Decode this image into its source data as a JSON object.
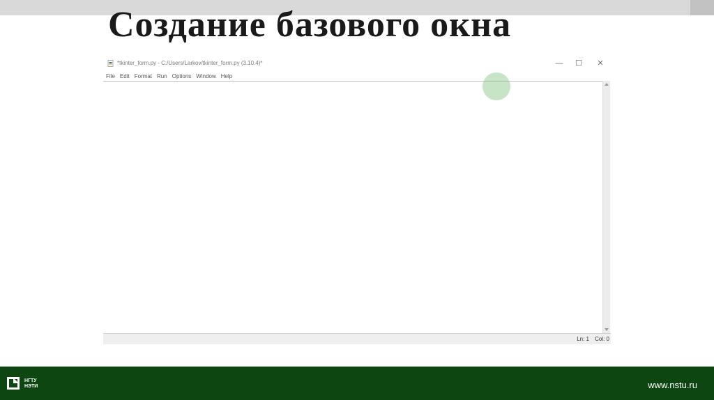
{
  "slide": {
    "title": "Создание базового окна",
    "footer_url": "www.nstu.ru",
    "logo_text": [
      "НГТУ",
      "НЭТИ"
    ]
  },
  "window": {
    "title": "*tkinter_form.py - C:/Users/Larkov/tkinter_form.py (3.10.4)*",
    "menu": [
      "File",
      "Edit",
      "Format",
      "Run",
      "Options",
      "Window",
      "Help"
    ],
    "controls": {
      "minimize": "—",
      "maximize": "☐",
      "close": "✕"
    },
    "editor_text": "",
    "status": {
      "line": "Ln: 1",
      "col": "Col: 0"
    }
  },
  "colors": {
    "footer_bg": "#0e4612",
    "top_band": "#d9d9d9",
    "cursor_highlight": "#82c482"
  },
  "icons": [
    "python-file-icon",
    "minimize-icon",
    "maximize-icon",
    "close-icon",
    "nstu-logo-icon"
  ]
}
